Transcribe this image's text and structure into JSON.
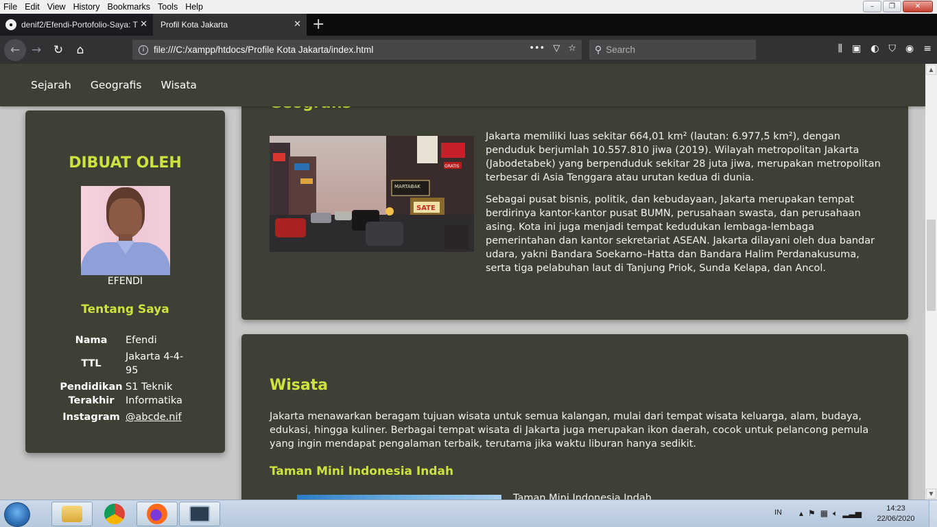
{
  "menu": [
    "File",
    "Edit",
    "View",
    "History",
    "Bookmarks",
    "Tools",
    "Help"
  ],
  "window_controls": {
    "minimize": "–",
    "maximize": "❐",
    "close": "✕"
  },
  "tabs": [
    {
      "title": "denif2/Efendi-Portofolio-Saya: T",
      "favicon": "github-icon",
      "active": false
    },
    {
      "title": "Profil Kota Jakarta",
      "favicon": "",
      "active": true
    }
  ],
  "toolbar": {
    "url": "file:///C:/xampp/htdocs/Profile Kota Jakarta/index.html",
    "search_placeholder": "Search",
    "page_actions": "•••"
  },
  "site": {
    "nav": [
      "Sejarah",
      "Geografis",
      "Wisata"
    ],
    "sidebar": {
      "heading": "DIBUAT OLEH",
      "name": "EFENDI",
      "about_heading": "Tentang Saya",
      "rows": [
        {
          "key": "Nama",
          "value": "Efendi"
        },
        {
          "key": "TTL",
          "value": "Jakarta 4-4-95"
        },
        {
          "key": "Pendidikan Terakhir",
          "value": "S1 Teknik Informatika"
        },
        {
          "key": "Instagram",
          "value": "@abcde.nif"
        }
      ]
    },
    "geografis": {
      "title": "Geografis",
      "p1": "Jakarta memiliki luas sekitar 664,01 km² (lautan: 6.977,5 km²), dengan penduduk berjumlah 10.557.810 jiwa (2019). Wilayah metropolitan Jakarta (Jabodetabek) yang berpenduduk sekitar 28 juta jiwa, merupakan metropolitan terbesar di Asia Tenggara atau urutan kedua di dunia.",
      "p2": "Sebagai pusat bisnis, politik, dan kebudayaan, Jakarta merupakan tempat berdirinya kantor-kantor pusat BUMN, perusahaan swasta, dan perusahaan asing. Kota ini juga menjadi tempat kedudukan lembaga-lembaga pemerintahan dan kantor sekretariat ASEAN. Jakarta dilayani oleh dua bandar udara, yakni Bandara Soekarno–Hatta dan Bandara Halim Perdanakusuma, serta tiga pelabuhan laut di Tanjung Priok, Sunda Kelapa, dan Ancol.",
      "image_signs": [
        "SATE",
        "MARTABAK",
        "GRATIS"
      ]
    },
    "wisata": {
      "title": "Wisata",
      "intro": "Jakarta menawarkan beragam tujuan wisata untuk semua kalangan, mulai dari tempat wisata keluarga, alam, budaya, edukasi, hingga kuliner. Berbagai tempat wisata di Jakarta juga merupakan ikon daerah, cocok untuk pelancong pemula yang ingin mendapat pengalaman terbaik, terutama jika waktu liburan hanya sedikit.",
      "subheading": "Taman Mini Indonesia Indah",
      "caption": "Taman Mini Indonesia Indah"
    }
  },
  "taskbar": {
    "apps": [
      "explorer-icon",
      "chrome-icon",
      "firefox-icon",
      "terminal-icon"
    ],
    "language": "IN",
    "time": "14:23",
    "date": "22/06/2020"
  },
  "colors": {
    "accent": "#cde23f",
    "panel": "#3f4035",
    "page_bg": "#c9c8c6"
  }
}
